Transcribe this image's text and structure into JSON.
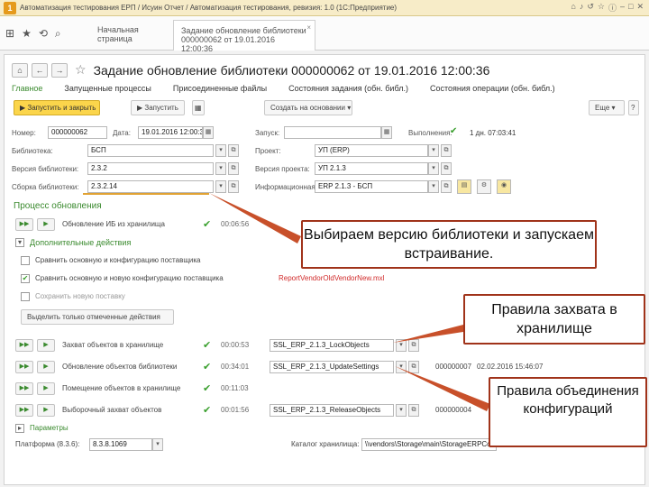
{
  "window": {
    "title": "Автоматизация тестирования ЕРП / Исуин Отчет / Автоматизация тестирования, ревизия: 1.0 (1С:Предприятие)",
    "tabs": [
      "Начальная страница",
      "Задание обновление библиотеки 000000062 от 19.01.2016 12:00:36"
    ]
  },
  "form": {
    "title": "Задание обновление библиотеки 000000062 от 19.01.2016 12:00:36",
    "nav": [
      "Главное",
      "Запущенные процессы",
      "Присоединенные файлы",
      "Состояния задания (обн. библ.)",
      "Состояния операции (обн. библ.)"
    ],
    "buttons": {
      "run_close": "Запустить и закрыть",
      "run": "Запустить",
      "copy": "Создать на основании",
      "more": "Еще",
      "help": "?"
    },
    "fields": {
      "number_label": "Номер:",
      "number": "000000062",
      "date_label": "Дата:",
      "date": "19.01.2016 12:00:36",
      "start_label": "Запуск:",
      "done_label": "Выполнения:",
      "done": "1 дн. 07:03:41",
      "library_label": "Библиотека:",
      "library": "БСП",
      "project_label": "Проект:",
      "project": "УП (ERP)",
      "libver_label": "Версия библиотеки:",
      "libver": "2.3.2",
      "projver_label": "Версия проекта:",
      "projver": "УП 2.1.3",
      "build_label": "Сборка библиотеки:",
      "build": "2.3.2.14",
      "infobase_label": "Информационная база:",
      "infobase": "ERP 2.1.3 - БСП"
    },
    "process": {
      "title": "Процесс обновления",
      "step1": "Обновление ИБ из хранилища",
      "step1_time": "00:06:56",
      "extra": "Дополнительные действия",
      "cmp1": "Сравнить основную и конфигурацию поставщика",
      "cmp2": "Сравнить основную и новую конфигурацию поставщика",
      "cmp2_link": "ReportVendorOldVendorNew.mxl",
      "save": "Сохранить новую поставку",
      "select_btn": "Выделить только отмеченные действия",
      "steps": [
        {
          "label": "Захват объектов в хранилище",
          "time": "00:00:53",
          "setting": "SSL_ERP_2.1.3_LockObjects",
          "doc": "000000007",
          "date": "02.02.2016 15:25:00"
        },
        {
          "label": "Обновление объектов библиотеки",
          "time": "00:34:01",
          "setting": "SSL_ERP_2.1.3_UpdateSettings",
          "doc": "000000007",
          "date": "02.02.2016 15:46:07"
        },
        {
          "label": "Помещение объектов в хранилище",
          "time": "00:11:03",
          "setting": "",
          "doc": "",
          "date": ""
        },
        {
          "label": "Выборочный захват объектов",
          "time": "00:01:56",
          "setting": "SSL_ERP_2.1.3_ReleaseObjects",
          "doc": "000000004",
          "date": ""
        }
      ],
      "params": "Параметры",
      "platform_label": "Платформа (8.3.6):",
      "platform": "8.3.8.1069",
      "dir_label": "Каталог хранилища:",
      "dir": "\\\\vendors\\Storage\\main\\StorageERPConcept\\"
    }
  },
  "callouts": {
    "c1": "Выбираем версию библиотеки и запускаем встраивание.",
    "c2": "Правила захвата в хранилище",
    "c3": "Правила объединения конфигураций"
  }
}
